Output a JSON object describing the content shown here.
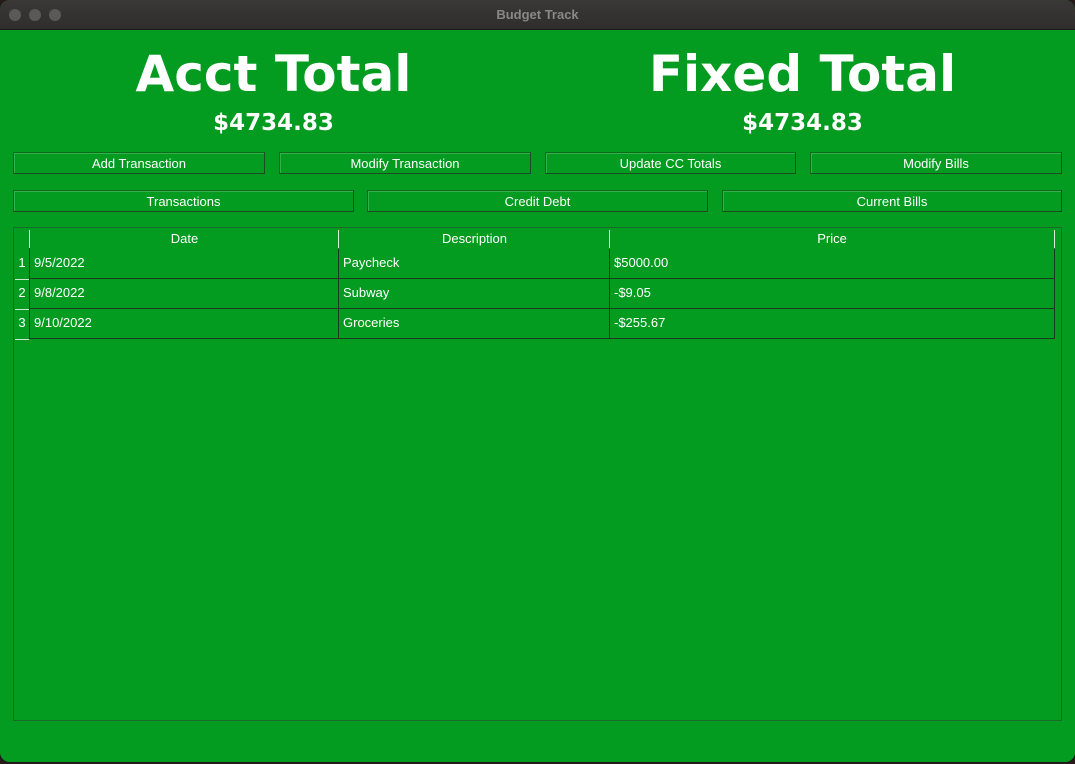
{
  "window": {
    "title": "Budget Track"
  },
  "summary": {
    "acct_label": "Acct Total",
    "acct_value": "$4734.83",
    "fixed_label": "Fixed Total",
    "fixed_value": "$4734.83"
  },
  "actions": {
    "add_transaction": "Add Transaction",
    "modify_transaction": "Modify Transaction",
    "update_cc_totals": "Update CC Totals",
    "modify_bills": "Modify Bills"
  },
  "views": {
    "transactions": "Transactions",
    "credit_debt": "Credit Debt",
    "current_bills": "Current Bills"
  },
  "table": {
    "columns": [
      "Date",
      "Description",
      "Price"
    ],
    "rows": [
      {
        "num": "1",
        "date": "9/5/2022",
        "description": "Paycheck",
        "price": "$5000.00"
      },
      {
        "num": "2",
        "date": "9/8/2022",
        "description": "Subway",
        "price": "-$9.05"
      },
      {
        "num": "3",
        "date": "9/10/2022",
        "description": "Groceries",
        "price": "-$255.67"
      }
    ]
  },
  "colors": {
    "background": "#039b20",
    "text": "#ffffff"
  }
}
